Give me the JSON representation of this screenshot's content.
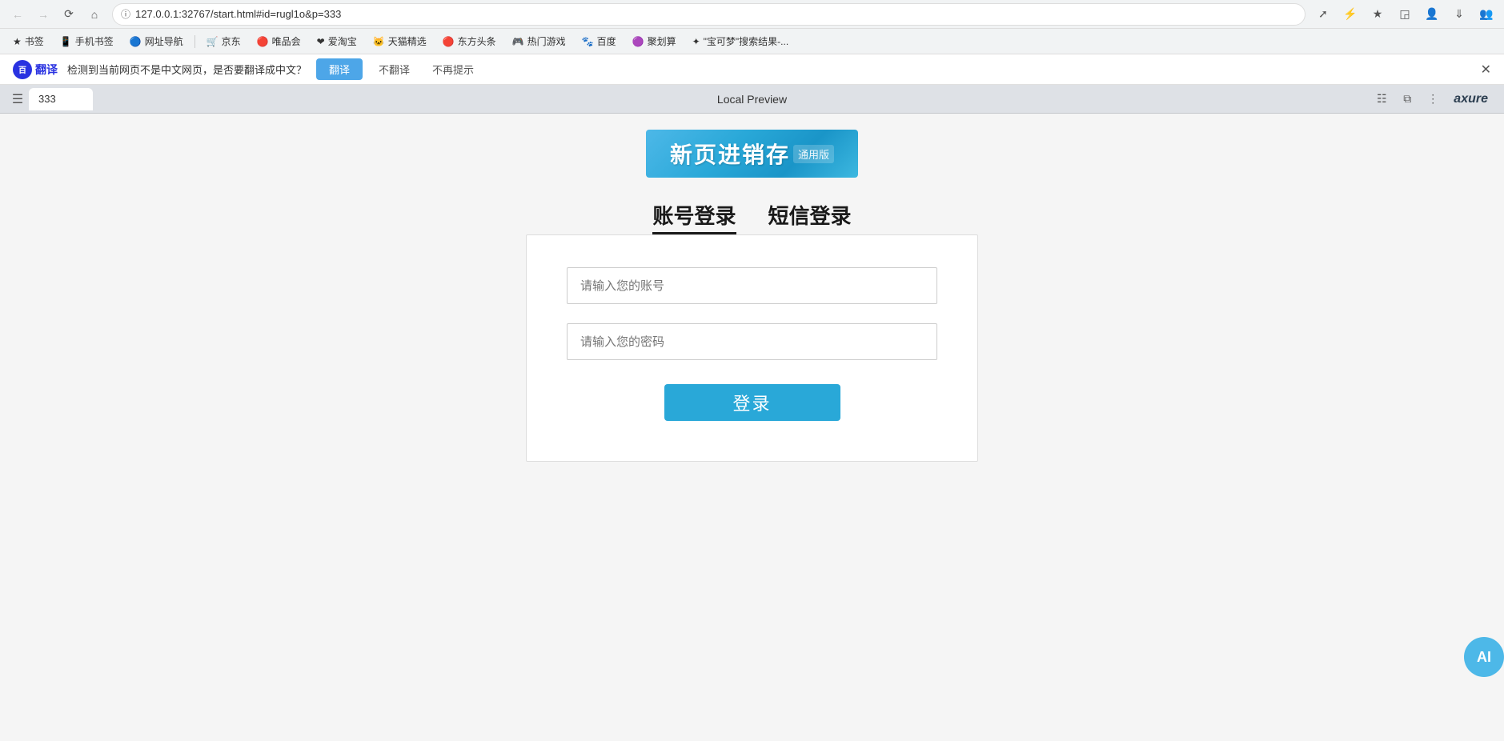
{
  "browser": {
    "url": "127.0.0.1:32767/start.html#id=rugl1o&p=333",
    "nav": {
      "back_disabled": true,
      "forward_disabled": true
    },
    "tab_title": "333",
    "page_title": "Local Preview",
    "axure_label": "axure"
  },
  "bookmarks": {
    "items": [
      {
        "id": "bookmarks",
        "label": "书签",
        "icon": "★"
      },
      {
        "id": "mobile",
        "label": "手机书签",
        "icon": "📱"
      },
      {
        "id": "nav",
        "label": "网址导航",
        "icon": "🔵"
      },
      {
        "id": "jd",
        "label": "京东",
        "icon": "🛒"
      },
      {
        "id": "wepin",
        "label": "唯品会",
        "icon": "🔴"
      },
      {
        "id": "taobao",
        "label": "爱淘宝",
        "icon": "❤"
      },
      {
        "id": "tmall",
        "label": "天猫精选",
        "icon": "🐱"
      },
      {
        "id": "dongfang",
        "label": "东方头条",
        "icon": "🔴"
      },
      {
        "id": "games",
        "label": "热门游戏",
        "icon": "🎮"
      },
      {
        "id": "baidu",
        "label": "百度",
        "icon": "🐾"
      },
      {
        "id": "juhui",
        "label": "聚划算",
        "icon": "🟣"
      },
      {
        "id": "doraemon",
        "label": "\"宝可梦\"搜索结果-...",
        "icon": "✦"
      }
    ]
  },
  "translation_bar": {
    "logo_text": "翻译",
    "message": "检测到当前网页不是中文网页，是否要翻译成中文？",
    "translate_btn": "翻译",
    "no_translate_btn": "不翻译",
    "never_btn": "不再提示"
  },
  "logo": {
    "main_text": "新页进销存",
    "sub_text": "通用版"
  },
  "login": {
    "tab_account": "账号登录",
    "tab_sms": "短信登录",
    "username_placeholder": "请输入您的账号",
    "password_placeholder": "请输入您的密码",
    "login_btn": "登录"
  },
  "floating": {
    "label": "AI"
  }
}
